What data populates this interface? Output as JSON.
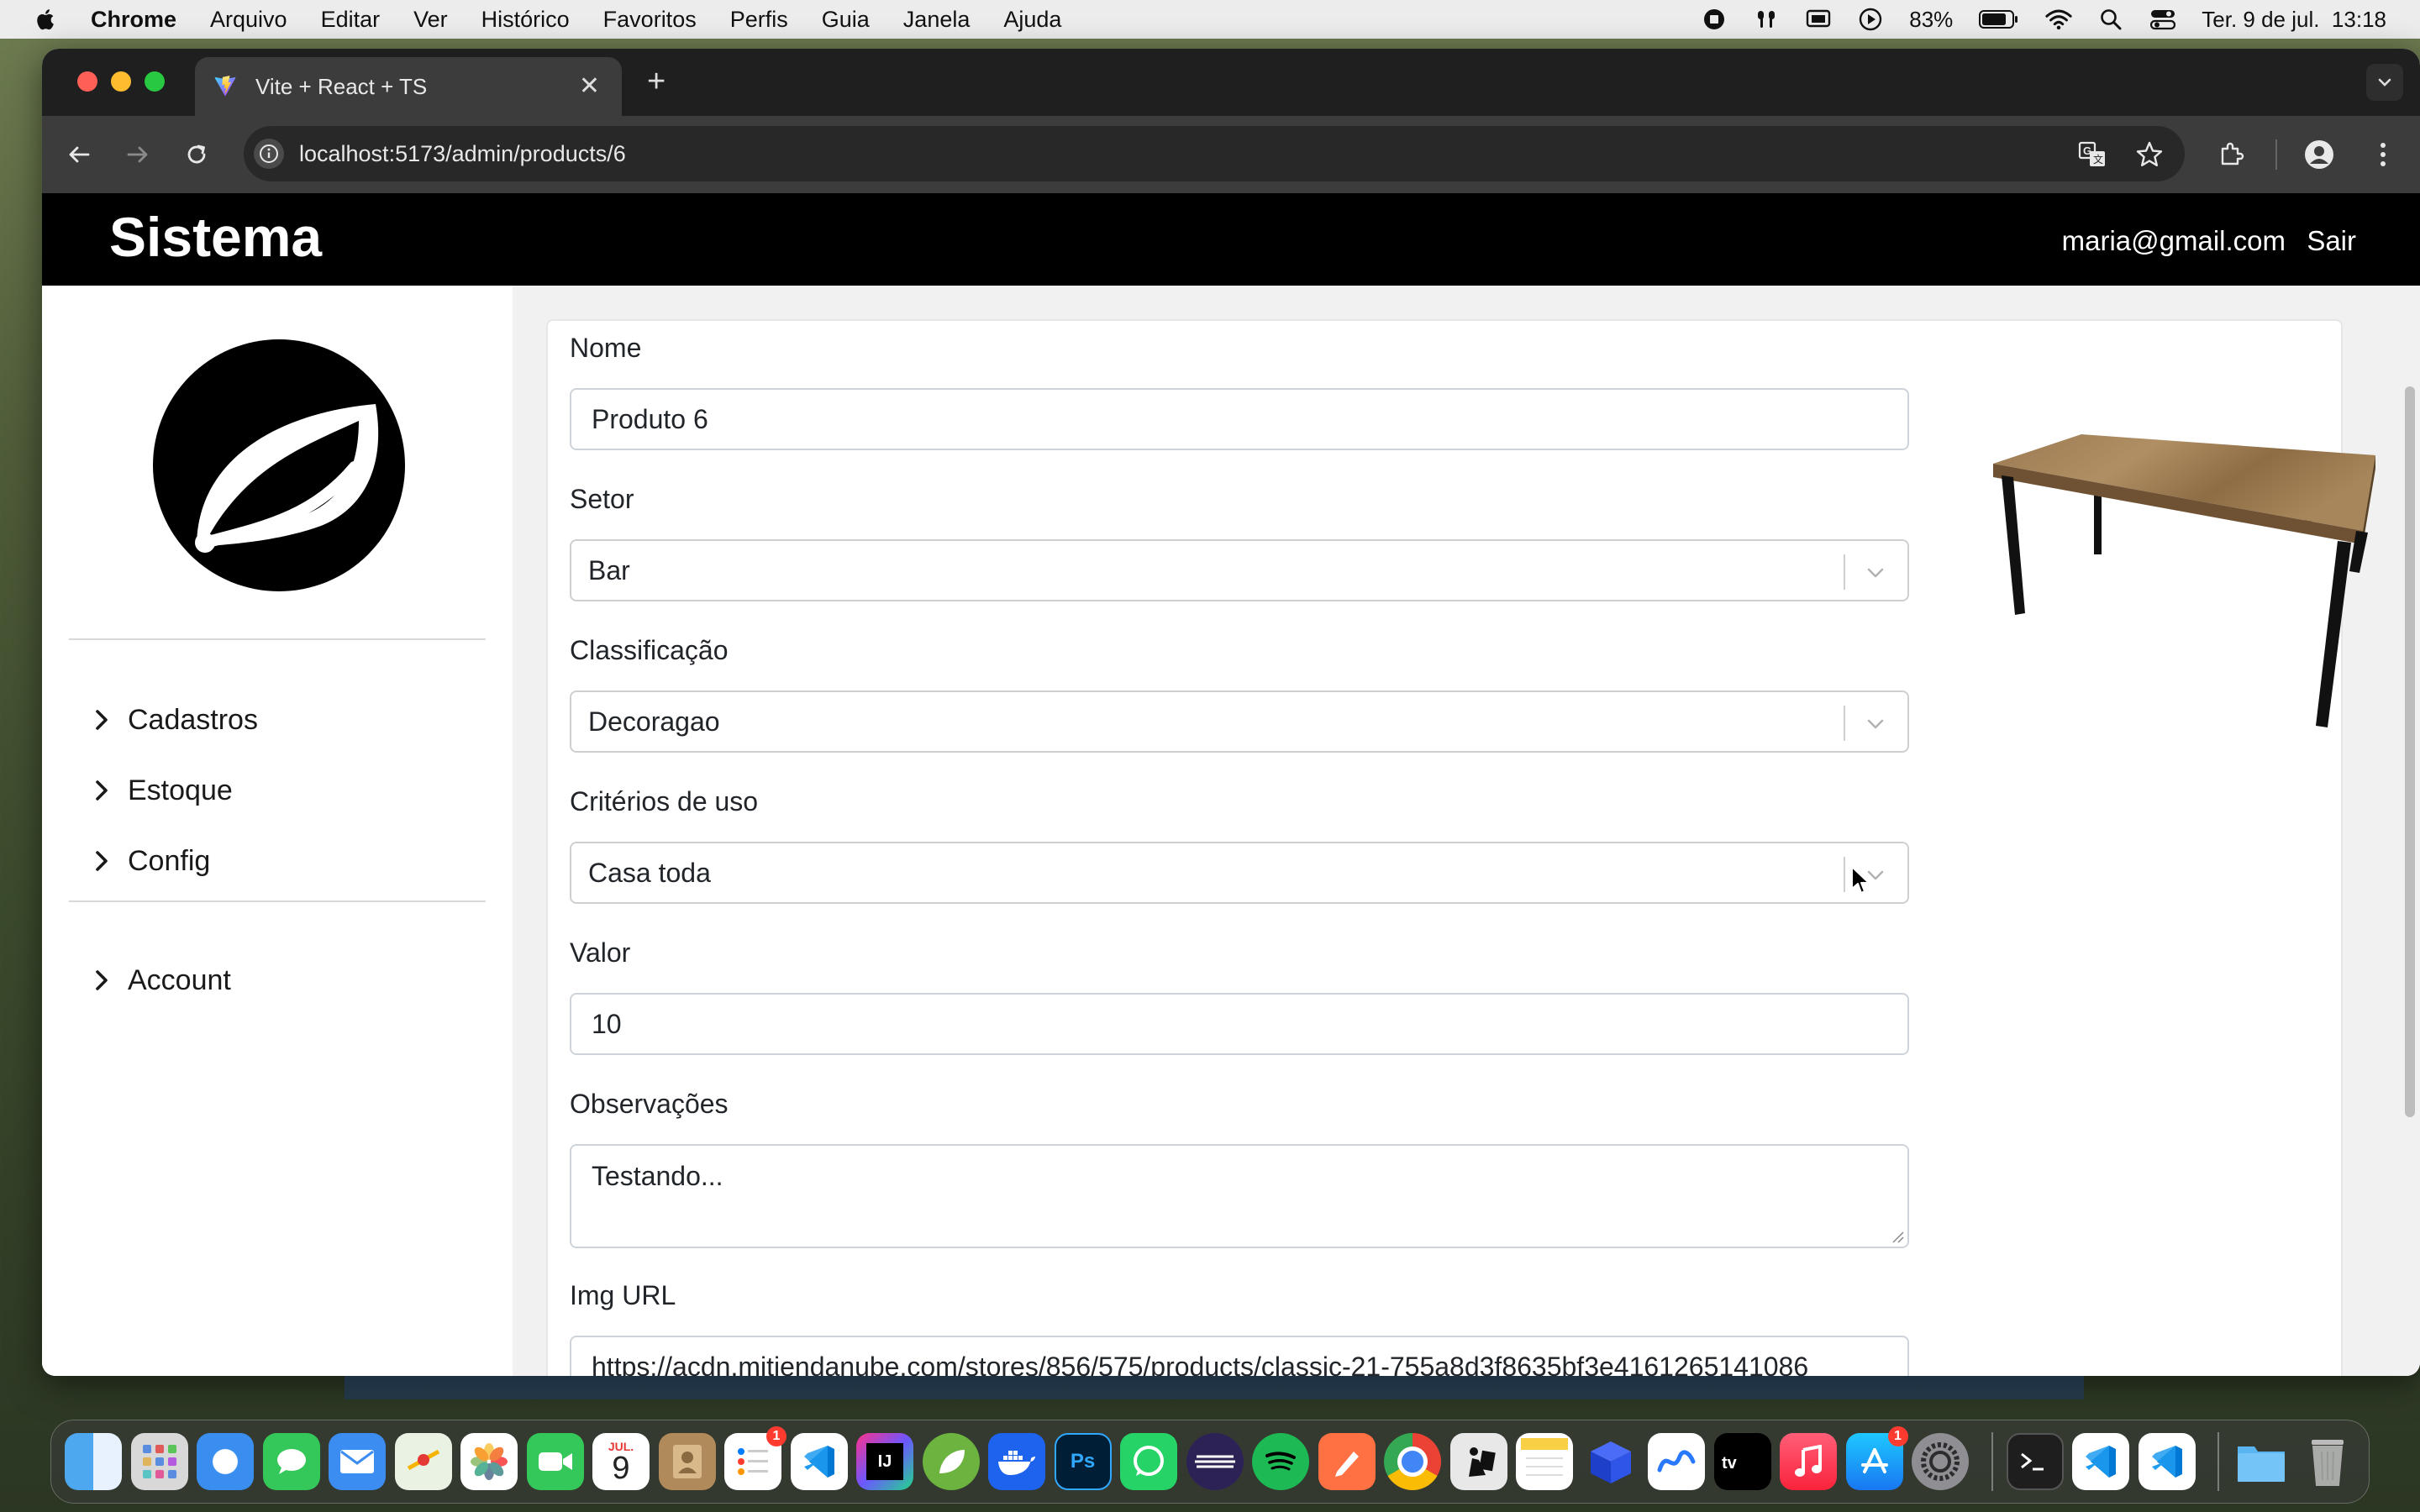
{
  "menubar": {
    "app_name": "Chrome",
    "items": [
      "Arquivo",
      "Editar",
      "Ver",
      "Histórico",
      "Favoritos",
      "Perfis",
      "Guia",
      "Janela",
      "Ajuda"
    ],
    "battery": "83%",
    "datetime": "Ter. 9 de jul.  13:18"
  },
  "browser": {
    "tab_title": "Vite + React + TS",
    "url": "localhost:5173/admin/products/6"
  },
  "header": {
    "brand": "Sistema",
    "user_email": "maria@gmail.com",
    "logout_label": "Sair"
  },
  "sidebar": {
    "items": [
      {
        "label": "Cadastros"
      },
      {
        "label": "Estoque"
      },
      {
        "label": "Config"
      }
    ],
    "account_label": "Account"
  },
  "form": {
    "name": {
      "label": "Nome",
      "value": "Produto 6"
    },
    "sector": {
      "label": "Setor",
      "value": "Bar"
    },
    "classification": {
      "label": "Classificação",
      "value": "Decoragao"
    },
    "usage_criteria": {
      "label": "Critérios de uso",
      "value": "Casa toda"
    },
    "price": {
      "label": "Valor",
      "value": "10"
    },
    "notes": {
      "label": "Observações",
      "value": "Testando..."
    },
    "img_url": {
      "label": "Img URL",
      "value": "https://acdn.mitiendanube.com/stores/856/575/products/classic-21-755a8d3f8635bf3e4161265141086"
    }
  },
  "dock": {
    "calendar_month": "JUL.",
    "calendar_day": "9",
    "reminders_badge": "1",
    "appstore_badge": "1"
  }
}
